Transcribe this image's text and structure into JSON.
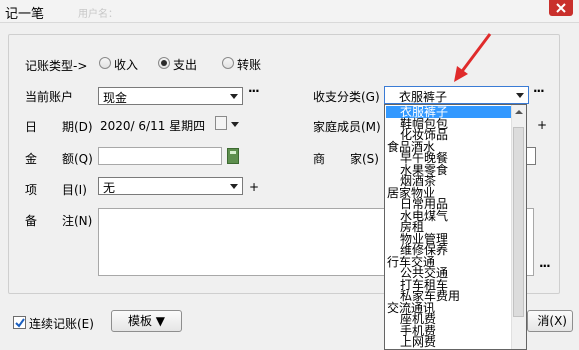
{
  "window": {
    "title": "记一笔",
    "ghost_text": "用户名："
  },
  "form": {
    "type_label": "记账类型->",
    "radios": [
      {
        "label": "收入",
        "checked": false
      },
      {
        "label": "支出",
        "checked": true
      },
      {
        "label": "转账",
        "checked": false
      }
    ],
    "account_label": "当前账户",
    "account_value": "现金",
    "date_label_a": "日",
    "date_label_b": "期(D)",
    "date_value": "2020/ 6/11 星期四",
    "amount_label_a": "金",
    "amount_label_b": "额(Q)",
    "amount_value": "",
    "item_label_a": "项",
    "item_label_b": "目(I)",
    "item_value": "无",
    "note_label_a": "备",
    "note_label_b": "注(N)",
    "note_value": "",
    "category_label": "收支分类(G)",
    "category_value": "衣服裤子",
    "family_label": "家庭成员(M)",
    "merchant_label_a": "商",
    "merchant_label_b": "家(S)",
    "dots": "···",
    "plus": "+"
  },
  "dropdown": {
    "items": [
      {
        "text": "衣服裤子",
        "level": 1,
        "selected": true
      },
      {
        "text": "鞋帽包包",
        "level": 1
      },
      {
        "text": "化妆饰品",
        "level": 1
      },
      {
        "text": "食品酒水",
        "level": 0
      },
      {
        "text": "早午晚餐",
        "level": 1
      },
      {
        "text": "水果零食",
        "level": 1
      },
      {
        "text": "烟酒茶",
        "level": 1
      },
      {
        "text": "居家物业",
        "level": 0
      },
      {
        "text": "日常用品",
        "level": 1
      },
      {
        "text": "水电煤气",
        "level": 1
      },
      {
        "text": "房租",
        "level": 1
      },
      {
        "text": "物业管理",
        "level": 1
      },
      {
        "text": "维修保养",
        "level": 1
      },
      {
        "text": "行车交通",
        "level": 0
      },
      {
        "text": "公共交通",
        "level": 1
      },
      {
        "text": "打车租车",
        "level": 1
      },
      {
        "text": "私家车费用",
        "level": 1
      },
      {
        "text": "交流通讯",
        "level": 0
      },
      {
        "text": "座机费",
        "level": 1
      },
      {
        "text": "手机费",
        "level": 1
      },
      {
        "text": "上网费",
        "level": 1
      }
    ]
  },
  "footer": {
    "continuous_label": "连续记账(E)",
    "continuous_checked": true,
    "template_label": "模板 ▼",
    "right_button_label": "消(X)"
  },
  "colors": {
    "selection": "#3399ff",
    "close": "#c9302c",
    "annotation_arrow": "#e02b2b"
  }
}
